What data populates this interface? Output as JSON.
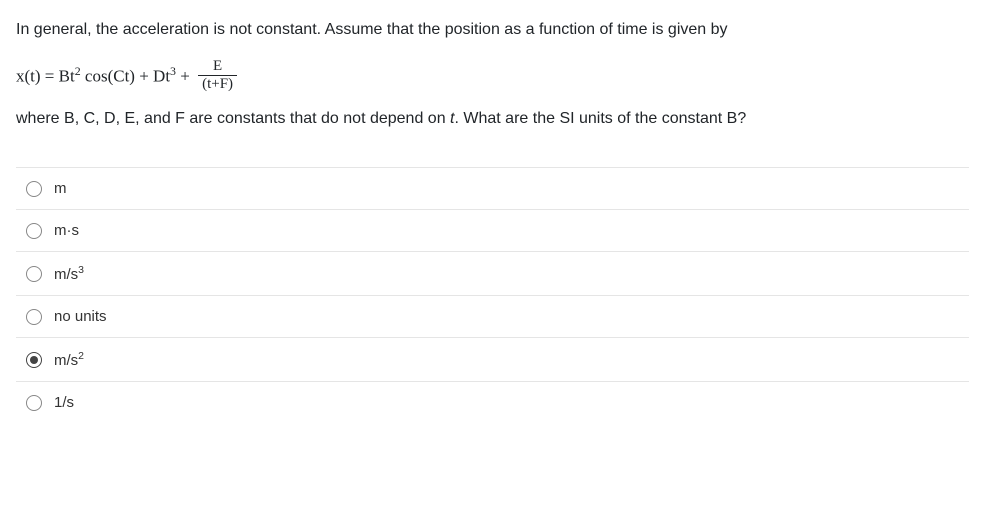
{
  "question": {
    "para1": "In general, the acceleration is not constant.  Assume that the position as a function of time is given by",
    "para2_prefix": "where B, C, D, E, and F are constants that do not depend on ",
    "para2_var": "t",
    "para2_suffix": ".  What are the SI units of the constant B?"
  },
  "equation": {
    "lhs": "x(t) = Bt",
    "exp1": "2",
    "mid1": " cos(Ct) + Dt",
    "exp2": "3",
    "mid2": " + ",
    "frac_num": "E",
    "frac_den": "(t+F)"
  },
  "options": [
    {
      "id": "opt-m",
      "html": "m",
      "selected": false
    },
    {
      "id": "opt-ms",
      "html": "m·s",
      "selected": false
    },
    {
      "id": "opt-mps3",
      "html": "m/s<sup>3</sup>",
      "selected": false
    },
    {
      "id": "opt-nounits",
      "html": "no units",
      "selected": false
    },
    {
      "id": "opt-mps2",
      "html": "m/s<sup>2</sup>",
      "selected": true
    },
    {
      "id": "opt-1ps",
      "html": "1/s",
      "selected": false
    }
  ]
}
